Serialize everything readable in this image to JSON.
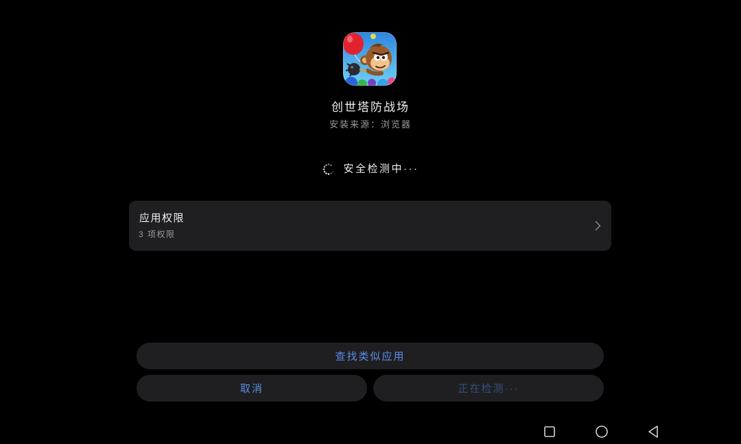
{
  "app": {
    "name": "创世塔防战场",
    "source": "安装来源：浏览器",
    "icon": "game-app-icon"
  },
  "scan": {
    "status": "安全检测中···",
    "icon": "loading-spinner-icon"
  },
  "permissions": {
    "title": "应用权限",
    "summary": "3 项权限",
    "icon": "chevron-right-icon"
  },
  "actions": {
    "find_similar": "查找类似应用",
    "cancel": "取消",
    "install_status": "正在检测···"
  },
  "nav": {
    "recents_icon": "square-icon",
    "home_icon": "circle-icon",
    "back_icon": "triangle-back-icon"
  },
  "colors": {
    "background": "#000000",
    "card": "#1f1f21",
    "accent": "#5a8de8",
    "accent_disabled": "#36517e",
    "text_primary": "#eeeeee",
    "text_secondary": "#9a9a9a"
  }
}
